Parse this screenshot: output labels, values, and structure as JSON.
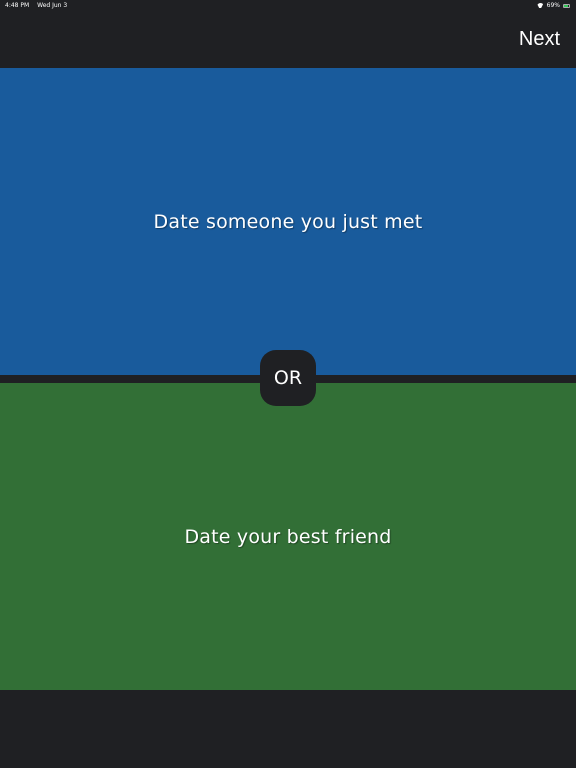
{
  "status_bar": {
    "time": "4:48 PM",
    "date": "Wed Jun 3",
    "battery": "69%"
  },
  "nav": {
    "next_label": "Next"
  },
  "options": {
    "top": {
      "text": "Date someone you just met",
      "color": "#195b9c"
    },
    "bottom": {
      "text": "Date your best friend",
      "color": "#326f36"
    }
  },
  "or_label": "OR",
  "colors": {
    "background": "#1f2023",
    "text": "#ffffff"
  }
}
